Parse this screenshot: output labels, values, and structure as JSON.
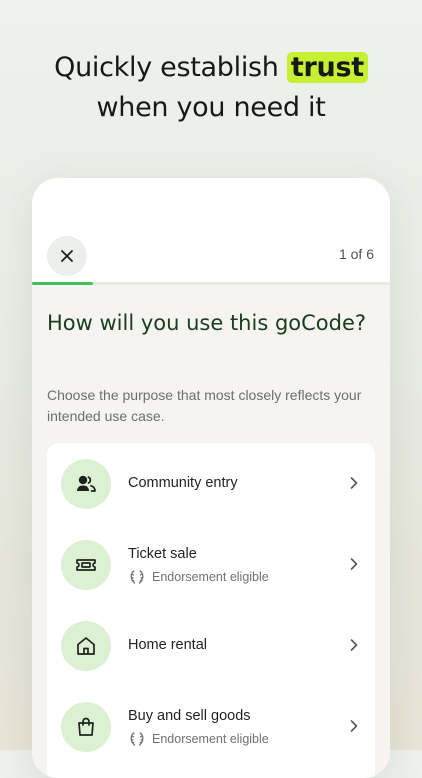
{
  "headline": {
    "pre": "Quickly establish ",
    "highlight": "trust",
    "line2": "when you need it"
  },
  "header": {
    "step": "1 of 6",
    "progress_fraction": 0.17
  },
  "main": {
    "title": "How will you use this goCode?",
    "subtitle": "Choose the purpose that most closely reflects your intended use case."
  },
  "options": [
    {
      "label": "Community entry",
      "icon": "people-icon"
    },
    {
      "label": "Ticket sale",
      "sub": "Endorsement eligible",
      "icon": "ticket-icon"
    },
    {
      "label": "Home rental",
      "icon": "house-icon"
    },
    {
      "label": "Buy and sell goods",
      "sub": "Endorsement eligible",
      "icon": "shopping-bag-icon"
    }
  ],
  "colors": {
    "accent_green": "#3cc35a",
    "highlight_lime": "#c8f032",
    "icon_bg": "#dcf0d2",
    "title_green": "#1a3d1f"
  }
}
